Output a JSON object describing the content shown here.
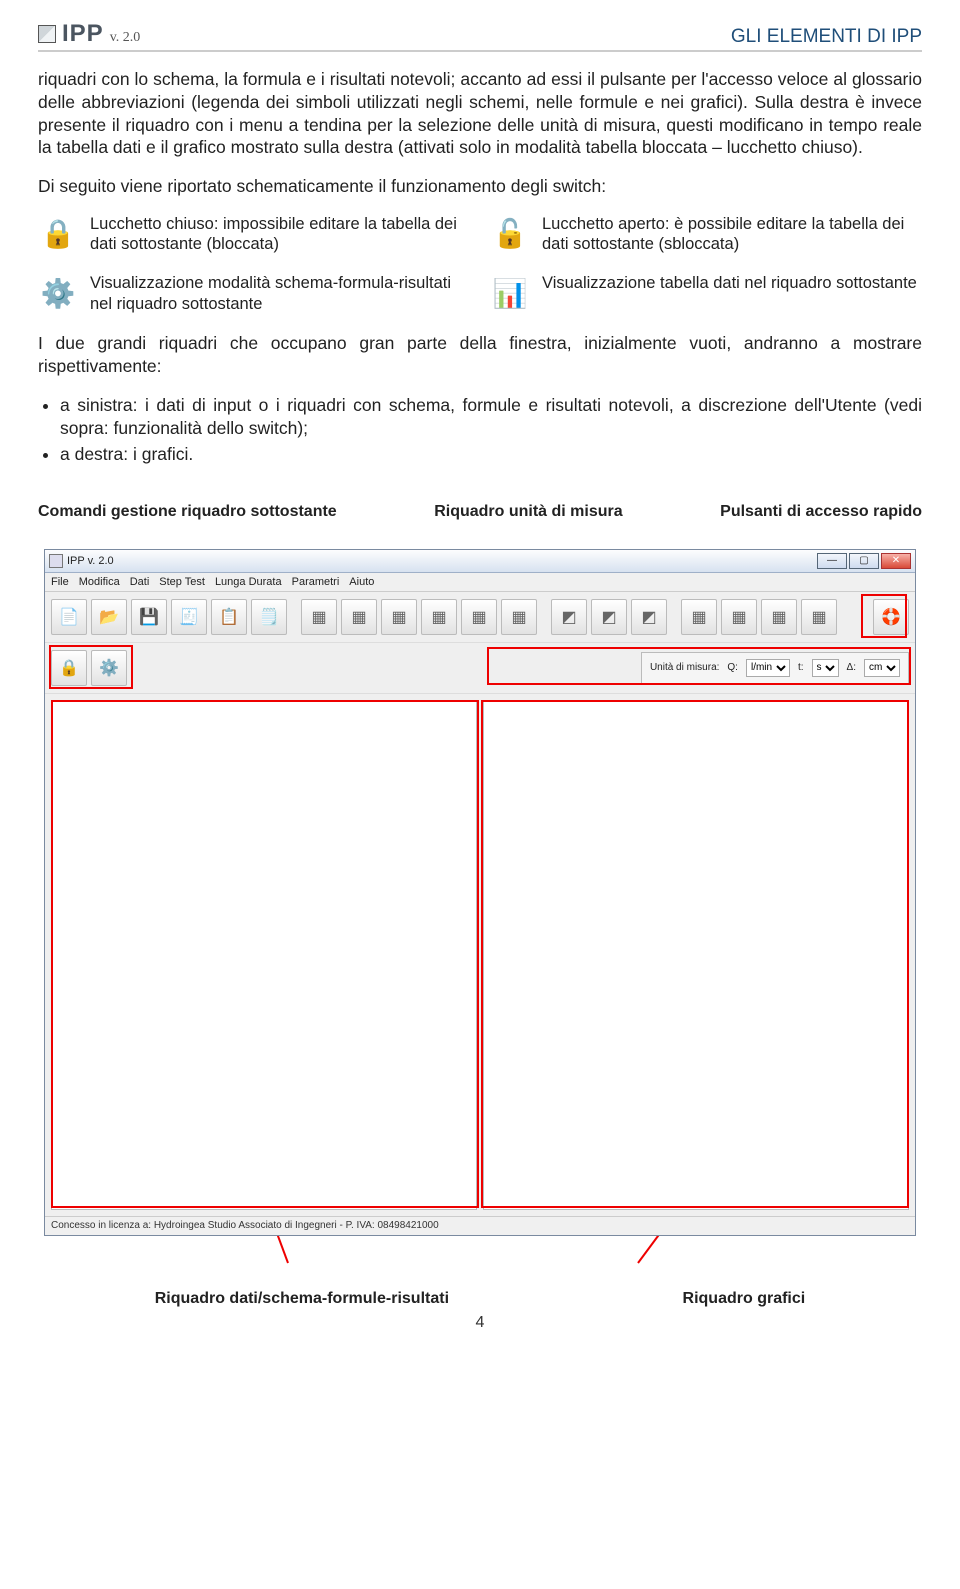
{
  "header": {
    "logo_main": "IPP",
    "logo_sub": "v. 2.0",
    "right": "GLI ELEMENTI DI IPP"
  },
  "para1": "riquadri con lo schema, la formula e i risultati notevoli; accanto ad essi il pulsante per l'accesso veloce al glossario delle abbreviazioni (legenda dei simboli utilizzati negli schemi, nelle formule e nei grafici). Sulla destra è invece presente il riquadro con i menu a tendina per la selezione delle unità di misura, questi modificano in tempo reale la tabella dati e il grafico mostrato sulla destra (attivati solo in modalità tabella bloccata – lucchetto chiuso).",
  "para2": "Di seguito viene riportato schematicamente il funzionamento degli switch:",
  "switches": {
    "lock_closed": "Lucchetto chiuso: impossibile editare la tabella dei dati sottostante (bloccata)",
    "lock_open": "Lucchetto aperto: è possibile editare la tabella dei dati sottostante (sbloccata)",
    "gear": "Visualizzazione modalità schema-formula-risultati nel riquadro sottostante",
    "table": "Visualizzazione tabella dati nel riquadro sottostante"
  },
  "para3": "I due grandi riquadri che occupano gran parte della finestra, inizialmente vuoti, andranno a mostrare rispettivamente:",
  "bullets": {
    "b1": "a sinistra: i dati di input o i riquadri con schema, formule e risultati notevoli, a discrezione dell'Utente (vedi sopra: funzionalità dello switch);",
    "b2": "a destra: i grafici."
  },
  "callouts_top": {
    "c1": "Comandi gestione riquadro sottostante",
    "c2": "Riquadro unità di misura",
    "c3": "Pulsanti di accesso rapido"
  },
  "app": {
    "title": "IPP v. 2.0",
    "menus": [
      "File",
      "Modifica",
      "Dati",
      "Step Test",
      "Lunga Durata",
      "Parametri",
      "Aiuto"
    ],
    "units_label": "Unità di misura:",
    "units": [
      {
        "label": "Q:",
        "value": "l/min"
      },
      {
        "label": "t:",
        "value": "s"
      },
      {
        "label": "Δ:",
        "value": "cm"
      }
    ],
    "status": "Concesso in licenza a: Hydroingea Studio Associato di Ingegneri - P. IVA: 08498421000"
  },
  "callouts_bottom": {
    "c1": "Riquadro dati/schema-formule-risultati",
    "c2": "Riquadro grafici"
  },
  "page_number": "4"
}
